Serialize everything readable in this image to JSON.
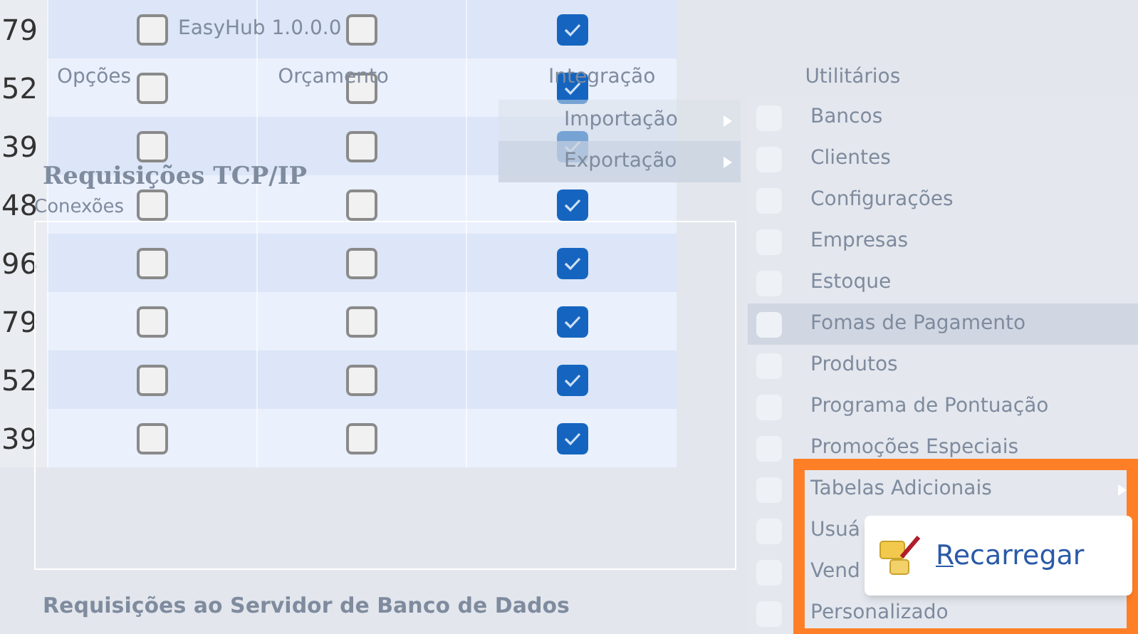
{
  "background_window": {
    "title": "EasyHub 1.0.0.0",
    "menu": [
      {
        "label": "Opções"
      },
      {
        "label": "Orçamento"
      },
      {
        "label": "Integração"
      },
      {
        "label": "Utilitários"
      }
    ],
    "integration_submenu": [
      {
        "label": "Importação",
        "selected": false
      },
      {
        "label": "Exportação",
        "selected": true
      }
    ],
    "tcp_section": {
      "title": "Requisições TCP/IP",
      "group_label": "Conexões"
    },
    "db_section": {
      "title": "Requisições ao Servidor de Banco de Dados"
    }
  },
  "utilities_menu": [
    {
      "label": "Bancos",
      "selected": false,
      "submenu": false
    },
    {
      "label": "Clientes",
      "selected": false,
      "submenu": false
    },
    {
      "label": "Configurações",
      "selected": false,
      "submenu": false
    },
    {
      "label": "Empresas",
      "selected": false,
      "submenu": false
    },
    {
      "label": "Estoque",
      "selected": false,
      "submenu": false
    },
    {
      "label": "Fomas de Pagamento",
      "selected": true,
      "submenu": false
    },
    {
      "label": "Produtos",
      "selected": false,
      "submenu": false
    },
    {
      "label": "Programa de Pontuação",
      "selected": false,
      "submenu": false
    },
    {
      "label": "Promoções Especiais",
      "selected": false,
      "submenu": false
    },
    {
      "label": "Tabelas Adicionais",
      "selected": false,
      "submenu": true
    },
    {
      "label": "Usuá",
      "selected": false,
      "submenu": false
    },
    {
      "label": "Vend",
      "selected": false,
      "submenu": false
    },
    {
      "label": "Personalizado",
      "selected": false,
      "submenu": false
    }
  ],
  "grid": {
    "rows": [
      {
        "id": "79",
        "checks": [
          false,
          false,
          true
        ]
      },
      {
        "id": "52",
        "checks": [
          false,
          false,
          true
        ]
      },
      {
        "id": "39",
        "checks": [
          false,
          false,
          true
        ]
      },
      {
        "id": "48",
        "checks": [
          false,
          false,
          true
        ]
      },
      {
        "id": "96",
        "checks": [
          false,
          false,
          true
        ]
      },
      {
        "id": "79",
        "checks": [
          false,
          false,
          true
        ]
      },
      {
        "id": "52",
        "checks": [
          false,
          false,
          true
        ]
      },
      {
        "id": "39",
        "checks": [
          false,
          false,
          true
        ]
      }
    ]
  },
  "popup": {
    "button": "Recarregar"
  }
}
